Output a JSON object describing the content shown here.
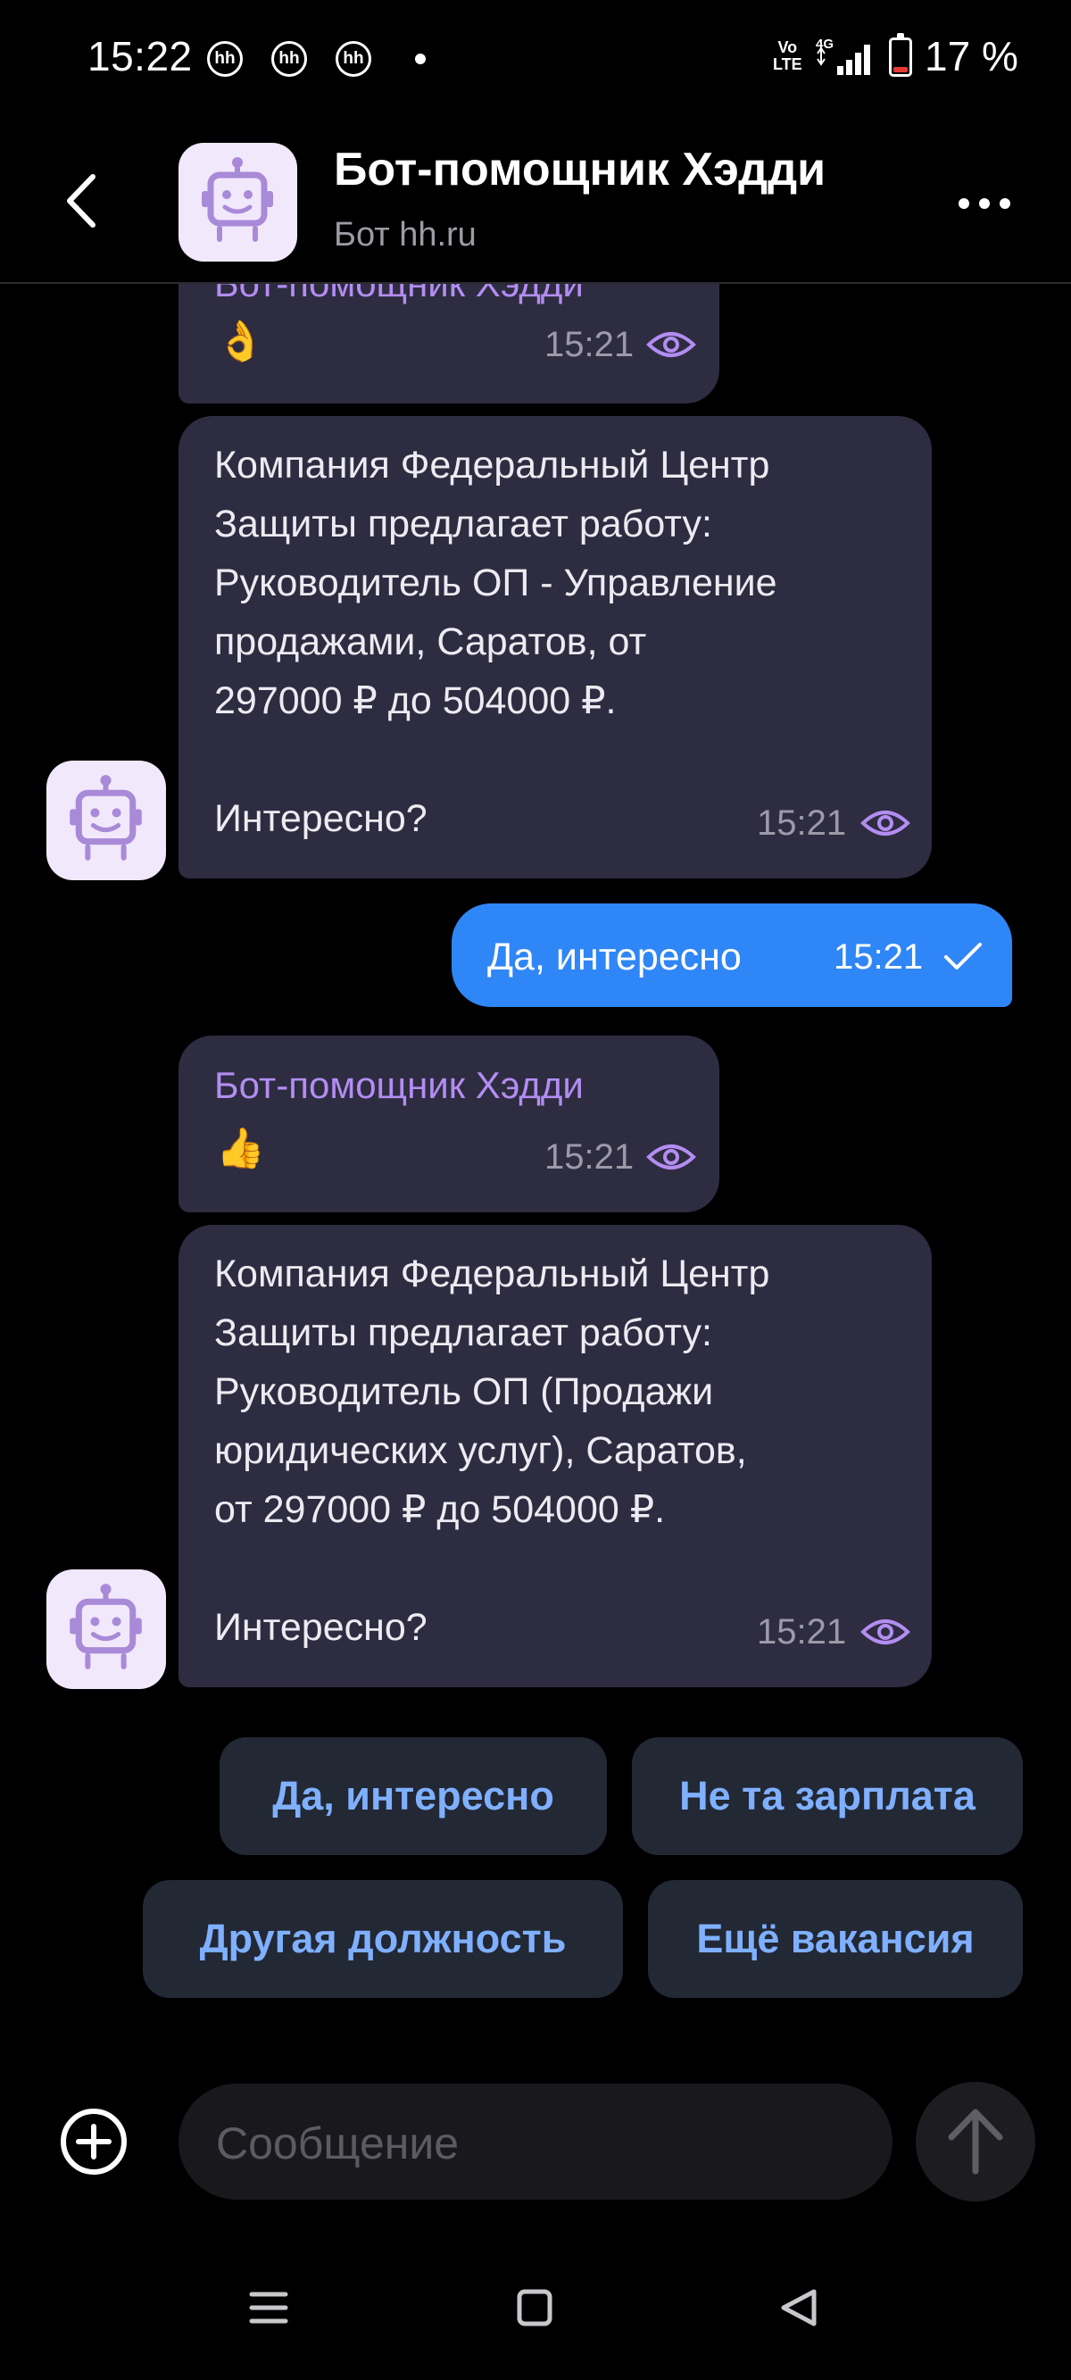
{
  "status_bar": {
    "time": "15:22",
    "notification_badges": [
      "hh",
      "hh",
      "hh"
    ],
    "volte": "Vo\nLTE",
    "network": "4G",
    "battery_percent": "17 %",
    "battery_level": 0.17,
    "battery_color": "#e53935"
  },
  "header": {
    "title": "Бот-помощник Хэдди",
    "subtitle": "Бот hh.ru",
    "back_icon": "chevron-left-icon",
    "more_icon": "more-horizontal-icon"
  },
  "messages": [
    {
      "direction": "incoming",
      "sender": "Бот-помощник Хэдди",
      "emoji": "👌",
      "time": "15:21",
      "status_icon": "eye-icon"
    },
    {
      "direction": "incoming",
      "text": "Компания Федеральный Центр\nЗащиты предлагает работу:\nРуководитель ОП - Управление\nпродажами, Саратов, от\n297000 ₽ до 504000 ₽.\n\nИнтересно?",
      "time": "15:21",
      "status_icon": "eye-icon"
    },
    {
      "direction": "outgoing",
      "text": "Да, интересно",
      "time": "15:21",
      "status_icon": "check-icon"
    },
    {
      "direction": "incoming",
      "sender": "Бот-помощник Хэдди",
      "emoji": "👍",
      "time": "15:21",
      "status_icon": "eye-icon"
    },
    {
      "direction": "incoming",
      "text": "Компания Федеральный Центр\nЗащиты предлагает работу:\nРуководитель ОП (Продажи\nюридических услуг), Саратов,\nот 297000 ₽ до 504000 ₽.\n\nИнтересно?",
      "time": "15:21",
      "status_icon": "eye-icon"
    }
  ],
  "quick_replies": [
    "Да, интересно",
    "Не та зарплата",
    "Другая должность",
    "Ещё вакансия"
  ],
  "composer": {
    "placeholder": "Сообщение",
    "add_icon": "plus-circle-icon",
    "send_icon": "arrow-up-icon"
  },
  "nav_bar": {
    "icons": [
      "menu-icon",
      "home-square-icon",
      "back-triangle-icon"
    ]
  },
  "colors": {
    "background": "#000000",
    "incoming_bubble": "#2e2c40",
    "outgoing_bubble": "#2f86f6",
    "sender_name": "#b38df2",
    "quick_reply_text": "#7fb0ff",
    "quick_reply_bg": "#232835",
    "avatar_bg": "#f1e8fb",
    "avatar_robot": "#a98ad8"
  }
}
